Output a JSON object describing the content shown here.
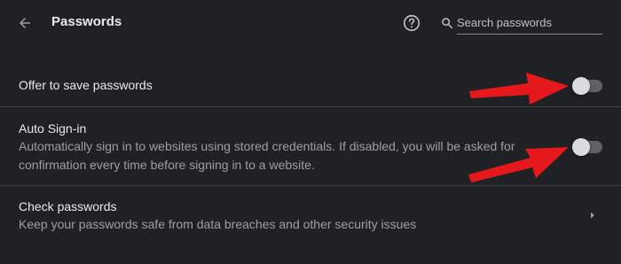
{
  "header": {
    "title": "Passwords",
    "back_icon": "arrow-left-icon",
    "help_icon": "help-circle-icon",
    "search": {
      "placeholder": "Search passwords",
      "value": "",
      "icon": "search-icon"
    }
  },
  "settings": {
    "offer_to_save": {
      "label": "Offer to save passwords",
      "enabled": false
    },
    "auto_signin": {
      "label": "Auto Sign-in",
      "description": "Automatically sign in to websites using stored credentials. If disabled, you will be asked for confirmation every time before signing in to a website.",
      "enabled": false
    },
    "check_passwords": {
      "label": "Check passwords",
      "description": "Keep your passwords safe from data breaches and other security issues",
      "icon": "chevron-right-icon"
    }
  },
  "annotations": {
    "arrow_color": "#e5181b"
  },
  "colors": {
    "background": "#202124",
    "text": "#e8eaed",
    "secondary_text": "#9aa0a6"
  }
}
